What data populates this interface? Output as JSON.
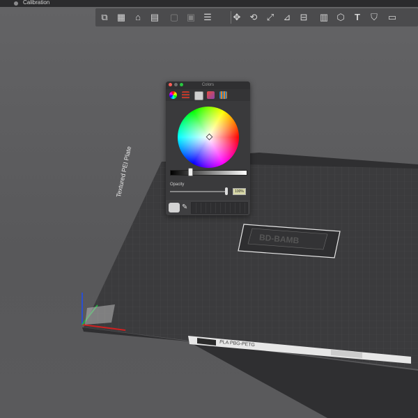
{
  "window": {
    "title": "Calibration"
  },
  "toolbar": {
    "buttons": [
      {
        "name": "add-object-icon",
        "glyph": "⧉"
      },
      {
        "name": "grid-arrange-icon",
        "glyph": "▦"
      },
      {
        "name": "plate-drop-icon",
        "glyph": "⌂"
      },
      {
        "name": "slice-view-icon",
        "glyph": "▤"
      },
      {
        "name": "disabled-tool-icon-1",
        "glyph": "▢"
      },
      {
        "name": "disabled-tool-icon-2",
        "glyph": "▣"
      },
      {
        "name": "list-view-icon",
        "glyph": "☰"
      },
      {
        "name": "move-tool-icon",
        "glyph": "✥"
      },
      {
        "name": "rotate-tool-icon",
        "glyph": "⟲"
      },
      {
        "name": "scale-tool-icon",
        "glyph": "⤢"
      },
      {
        "name": "place-on-face-icon",
        "glyph": "⊿"
      },
      {
        "name": "cut-tool-icon",
        "glyph": "⊟"
      },
      {
        "name": "support-paint-icon",
        "glyph": "▥"
      },
      {
        "name": "seam-paint-icon",
        "glyph": "⬡"
      },
      {
        "name": "text-tool-icon",
        "glyph": "T"
      },
      {
        "name": "color-paint-icon",
        "glyph": "⛉"
      },
      {
        "name": "measure-tool-icon",
        "glyph": "▭"
      }
    ]
  },
  "plate": {
    "side_label": "Textured PEI Plate",
    "front_label": "PLA PBG-PETG",
    "model_text": "BD-BAMB"
  },
  "colors_panel": {
    "title": "Colors",
    "opacity_label": "Opacity",
    "opacity_value": "100%",
    "selected_color": "#d3d3d3",
    "tabs": [
      "color-wheel-tab",
      "color-sliders-tab",
      "color-palettes-tab",
      "image-palettes-tab",
      "pencils-tab"
    ]
  }
}
